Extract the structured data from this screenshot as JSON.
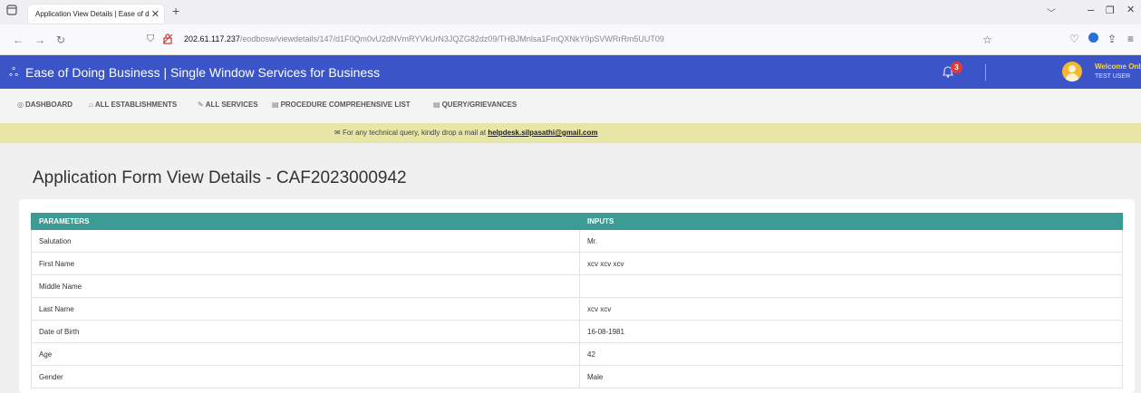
{
  "browser": {
    "tab_title": "Application View Details | Ease of d",
    "url_host": "202.61.117.237",
    "url_path": "/eodbosw/viewdetails/147/d1F0Qm0vU2dNVmRYVkUrN3JQZG82dz09/THBJMnlsa1FmQXNkY0pSVWRrRm5UUT09"
  },
  "header": {
    "brand_title": "Ease of Doing Business | Single Window Services for Business",
    "notification_count": "3",
    "welcome_text": "Welcome Onboard",
    "user_name": "TEST USER"
  },
  "nav": {
    "items": [
      {
        "label": "DASHBOARD",
        "icon": "dashboard-icon"
      },
      {
        "label": "ALL ESTABLISHMENTS",
        "icon": "building-icon"
      },
      {
        "label": "ALL SERVICES",
        "icon": "wrench-icon"
      },
      {
        "label": "PROCEDURE COMPREHENSIVE LIST",
        "icon": "list-icon"
      },
      {
        "label": "QUERY/GRIEVANCES",
        "icon": "list-icon"
      }
    ]
  },
  "notice": {
    "text": "For any technical query, kindly drop a mail at",
    "email": "helpdesk.silpasathi@gmail.com"
  },
  "page": {
    "title": "Application Form View Details - CAF2023000942"
  },
  "table": {
    "headers": [
      "PARAMETERS",
      "INPUTS"
    ],
    "rows": [
      [
        "Salutation",
        "Mr."
      ],
      [
        "First Name",
        "xcv xcv xcv"
      ],
      [
        "Middle Name",
        ""
      ],
      [
        "Last Name",
        "xcv xcv"
      ],
      [
        "Date of Birth",
        "16-08-1981"
      ],
      [
        "Age",
        "42"
      ],
      [
        "Gender",
        "Male"
      ]
    ]
  },
  "colors": {
    "header_bg": "#3b55c9",
    "table_header_bg": "#3d9b95",
    "notice_bg": "#e8e6a6",
    "badge_bg": "#e53935"
  }
}
